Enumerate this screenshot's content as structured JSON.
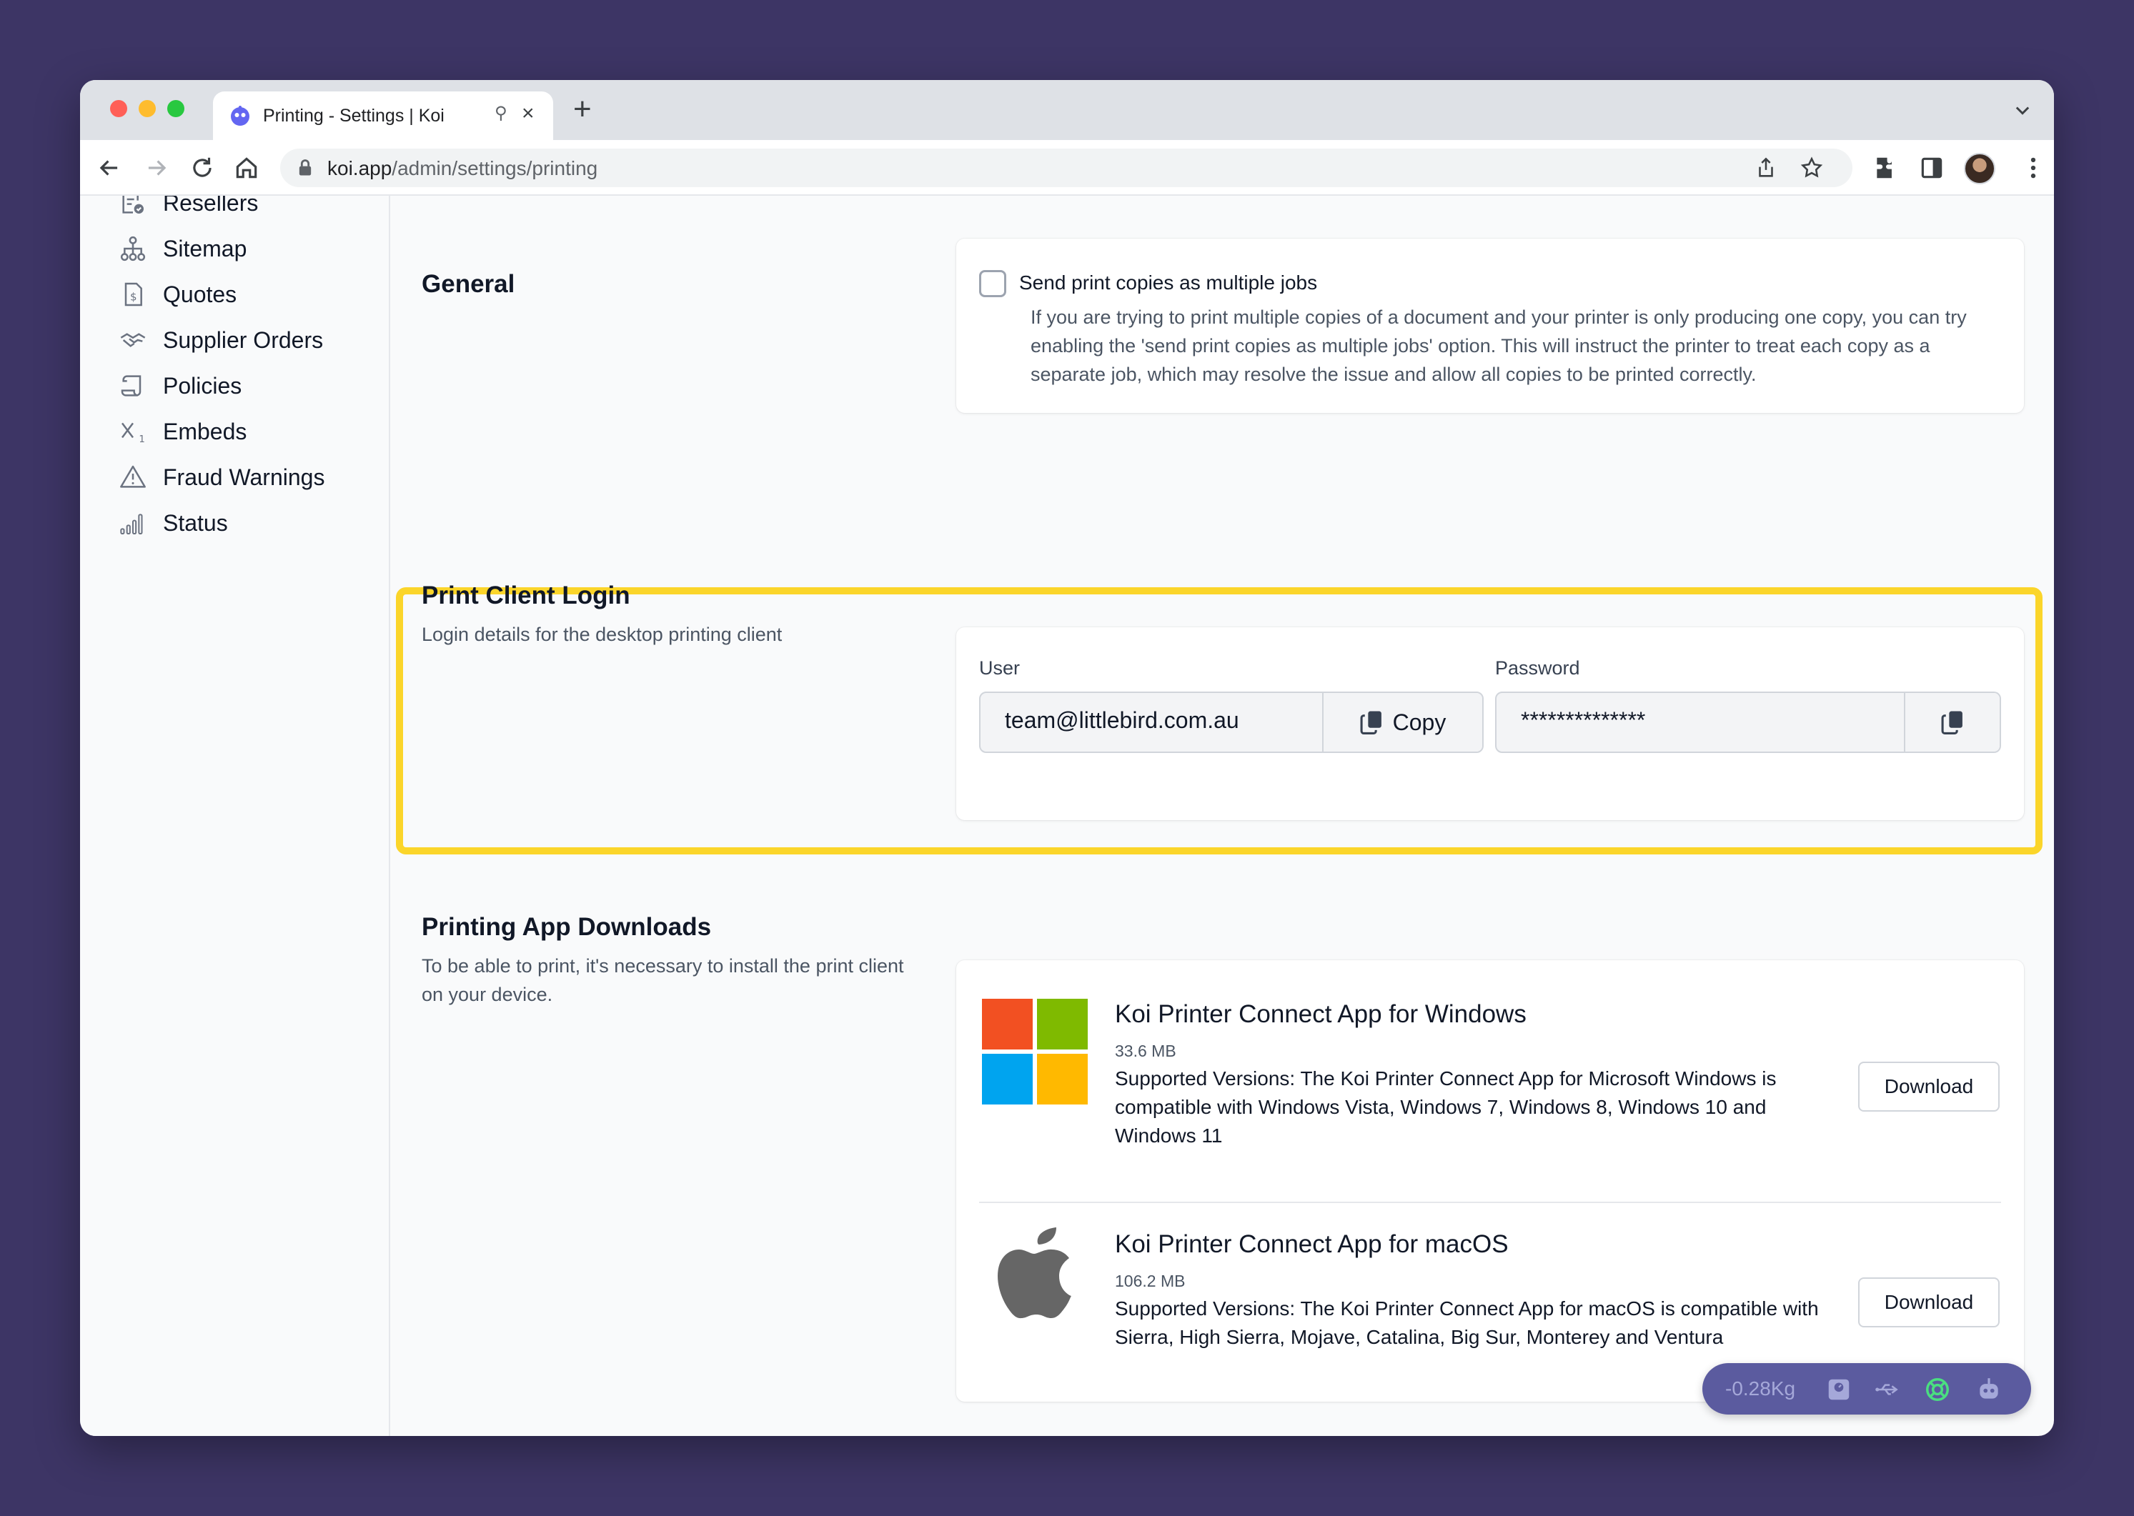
{
  "browser": {
    "tab_title": "Printing - Settings | Koi",
    "url_host": "koi.app",
    "url_path": "/admin/settings/printing"
  },
  "sidebar": {
    "items": [
      {
        "label": "Resellers",
        "icon": "resellers-icon"
      },
      {
        "label": "Sitemap",
        "icon": "sitemap-icon"
      },
      {
        "label": "Quotes",
        "icon": "quote-icon"
      },
      {
        "label": "Supplier Orders",
        "icon": "handshake-icon"
      },
      {
        "label": "Policies",
        "icon": "scroll-icon"
      },
      {
        "label": "Embeds",
        "icon": "subscript-icon"
      },
      {
        "label": "Fraud Warnings",
        "icon": "warning-icon"
      },
      {
        "label": "Status",
        "icon": "signal-icon"
      }
    ]
  },
  "general": {
    "title": "General",
    "checkbox_label": "Send print copies as multiple jobs",
    "checkbox_checked": false,
    "help_text": "If you are trying to print multiple copies of a document and your printer is only producing one copy, you can try enabling the 'send print copies as multiple jobs' option. This will instruct the printer to treat each copy as a separate job, which may resolve the issue and allow all copies to be printed correctly."
  },
  "print_client_login": {
    "title": "Print Client Login",
    "description": "Login details for the desktop printing client",
    "user_label": "User",
    "user_value": "team@littlebird.com.au",
    "copy_label": "Copy",
    "password_label": "Password",
    "password_value": "**************",
    "highlight_color": "#fbd52a"
  },
  "downloads": {
    "title": "Printing App Downloads",
    "description": "To be able to print, it's necessary to install the print client on your device.",
    "apps": [
      {
        "title": "Koi Printer Connect App for Windows",
        "size": "33.6 MB",
        "description": "Supported Versions: The Koi Printer Connect App for Microsoft Windows is compatible with Windows Vista, Windows 7, Windows 8, Windows 10 and Windows 11",
        "button": "Download",
        "logo": "windows-logo"
      },
      {
        "title": "Koi Printer Connect App for macOS",
        "size": "106.2 MB",
        "description": "Supported Versions: The Koi Printer Connect App for macOS is compatible with Sierra, High Sierra, Mojave, Catalina, Big Sur, Monterey and Ventura",
        "button": "Download",
        "logo": "apple-logo"
      }
    ]
  },
  "status_bar": {
    "weight": "-0.28Kg",
    "icons": [
      "scale-icon",
      "usb-icon",
      "lifebuoy-icon",
      "robot-icon"
    ],
    "lifebuoy_color": "#4ade80"
  }
}
